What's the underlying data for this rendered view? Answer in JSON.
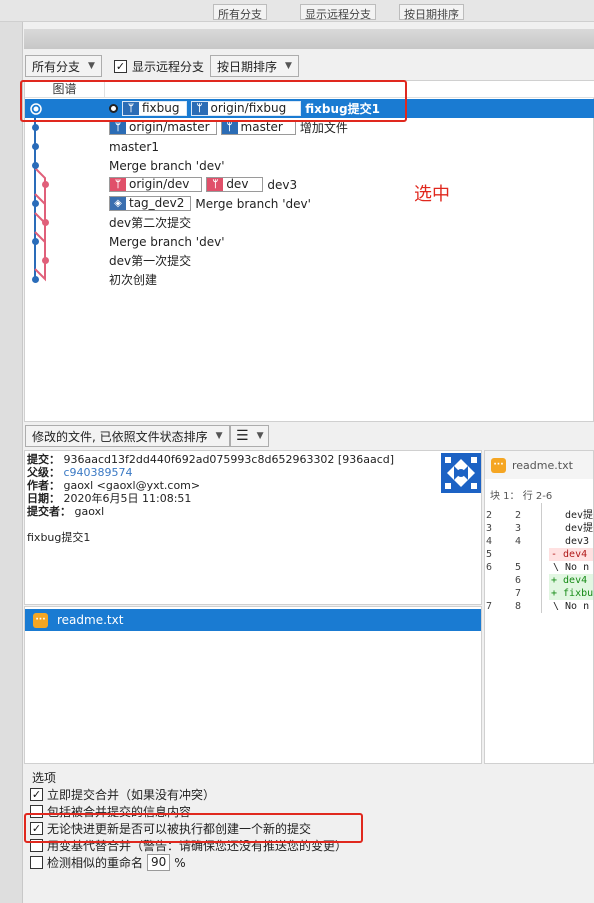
{
  "background_window": {
    "branch_filter": "所有分支",
    "show_remote": "显示远程分支",
    "sort": "按日期排序"
  },
  "toolbar": {
    "branch_filter": "所有分支",
    "show_remote_label": "显示远程分支",
    "show_remote_checked": true,
    "sort_label": "按日期排序"
  },
  "graph": {
    "header": "图谱",
    "annotation": "选中",
    "commits": [
      {
        "refs": [
          {
            "kind": "local",
            "name": "fixbug"
          },
          {
            "kind": "local",
            "name": "origin/fixbug"
          }
        ],
        "message": "fixbug提交1",
        "selected": true,
        "head": true
      },
      {
        "refs": [
          {
            "kind": "local",
            "name": "origin/master"
          },
          {
            "kind": "local",
            "name": "master"
          }
        ],
        "message": "增加文件"
      },
      {
        "refs": [],
        "message": "master1"
      },
      {
        "refs": [],
        "message": "Merge branch 'dev'"
      },
      {
        "refs": [
          {
            "kind": "dev",
            "name": "origin/dev"
          },
          {
            "kind": "dev",
            "name": "dev"
          }
        ],
        "message": "dev3"
      },
      {
        "refs": [
          {
            "kind": "tag",
            "name": "tag_dev2"
          }
        ],
        "message": "Merge branch 'dev'"
      },
      {
        "refs": [],
        "message": "dev第二次提交"
      },
      {
        "refs": [],
        "message": "Merge branch 'dev'"
      },
      {
        "refs": [],
        "message": "dev第一次提交"
      },
      {
        "refs": [],
        "message": "初次创建"
      }
    ],
    "colors": {
      "main": "#2a6cb9",
      "dev": "#e0607a",
      "selection": "#1a7bd2"
    }
  },
  "file_list": {
    "sort_label": "修改的文件, 已依照文件状态排序",
    "view_icon": "list-icon",
    "files": [
      "readme.txt"
    ]
  },
  "commit_info": {
    "commit_label": "提交：",
    "commit_value": "936aacd13f2dd440f692ad075993c8d652963302 [936aacd]",
    "parent_label": "父级：",
    "parent_value": "c940389574",
    "author_label": "作者：",
    "author_value": "gaoxl <gaoxl@yxt.com>",
    "date_label": "日期：",
    "date_value": "2020年6月5日 11:08:51",
    "committer_label": "提交者：",
    "committer_value": "gaoxl",
    "message": "fixbug提交1"
  },
  "diff": {
    "filename": "readme.txt",
    "hunk": "块 1： 行 2-6",
    "lines": [
      {
        "n1": "2",
        "n2": "2",
        "text": "dev提",
        "kind": "ctx"
      },
      {
        "n1": "3",
        "n2": "3",
        "text": "dev提",
        "kind": "ctx"
      },
      {
        "n1": "4",
        "n2": "4",
        "text": "dev3",
        "kind": "ctx"
      },
      {
        "n1": "5",
        "n2": "",
        "text": "- dev4",
        "kind": "del"
      },
      {
        "n1": "6",
        "n2": "5",
        "text": "\\  No n",
        "kind": "ctx"
      },
      {
        "n1": "",
        "n2": "6",
        "text": "+ dev4",
        "kind": "add"
      },
      {
        "n1": "",
        "n2": "7",
        "text": "+ fixbu",
        "kind": "add"
      },
      {
        "n1": "7",
        "n2": "8",
        "text": "\\  No n",
        "kind": "ctx"
      }
    ]
  },
  "options": {
    "title": "选项",
    "items": [
      {
        "label": "立即提交合并（如果没有冲突）",
        "checked": true
      },
      {
        "label": "包括被合并提交的信息内容",
        "checked": false
      },
      {
        "label": "无论快进更新是否可以被执行都创建一个新的提交",
        "checked": true
      },
      {
        "label": "用变基代替合并（警告：请确保您还没有推送您的变更）",
        "checked": false
      },
      {
        "label": "检测相似的重命名",
        "checked": false,
        "value": "90",
        "unit": "%"
      }
    ]
  }
}
